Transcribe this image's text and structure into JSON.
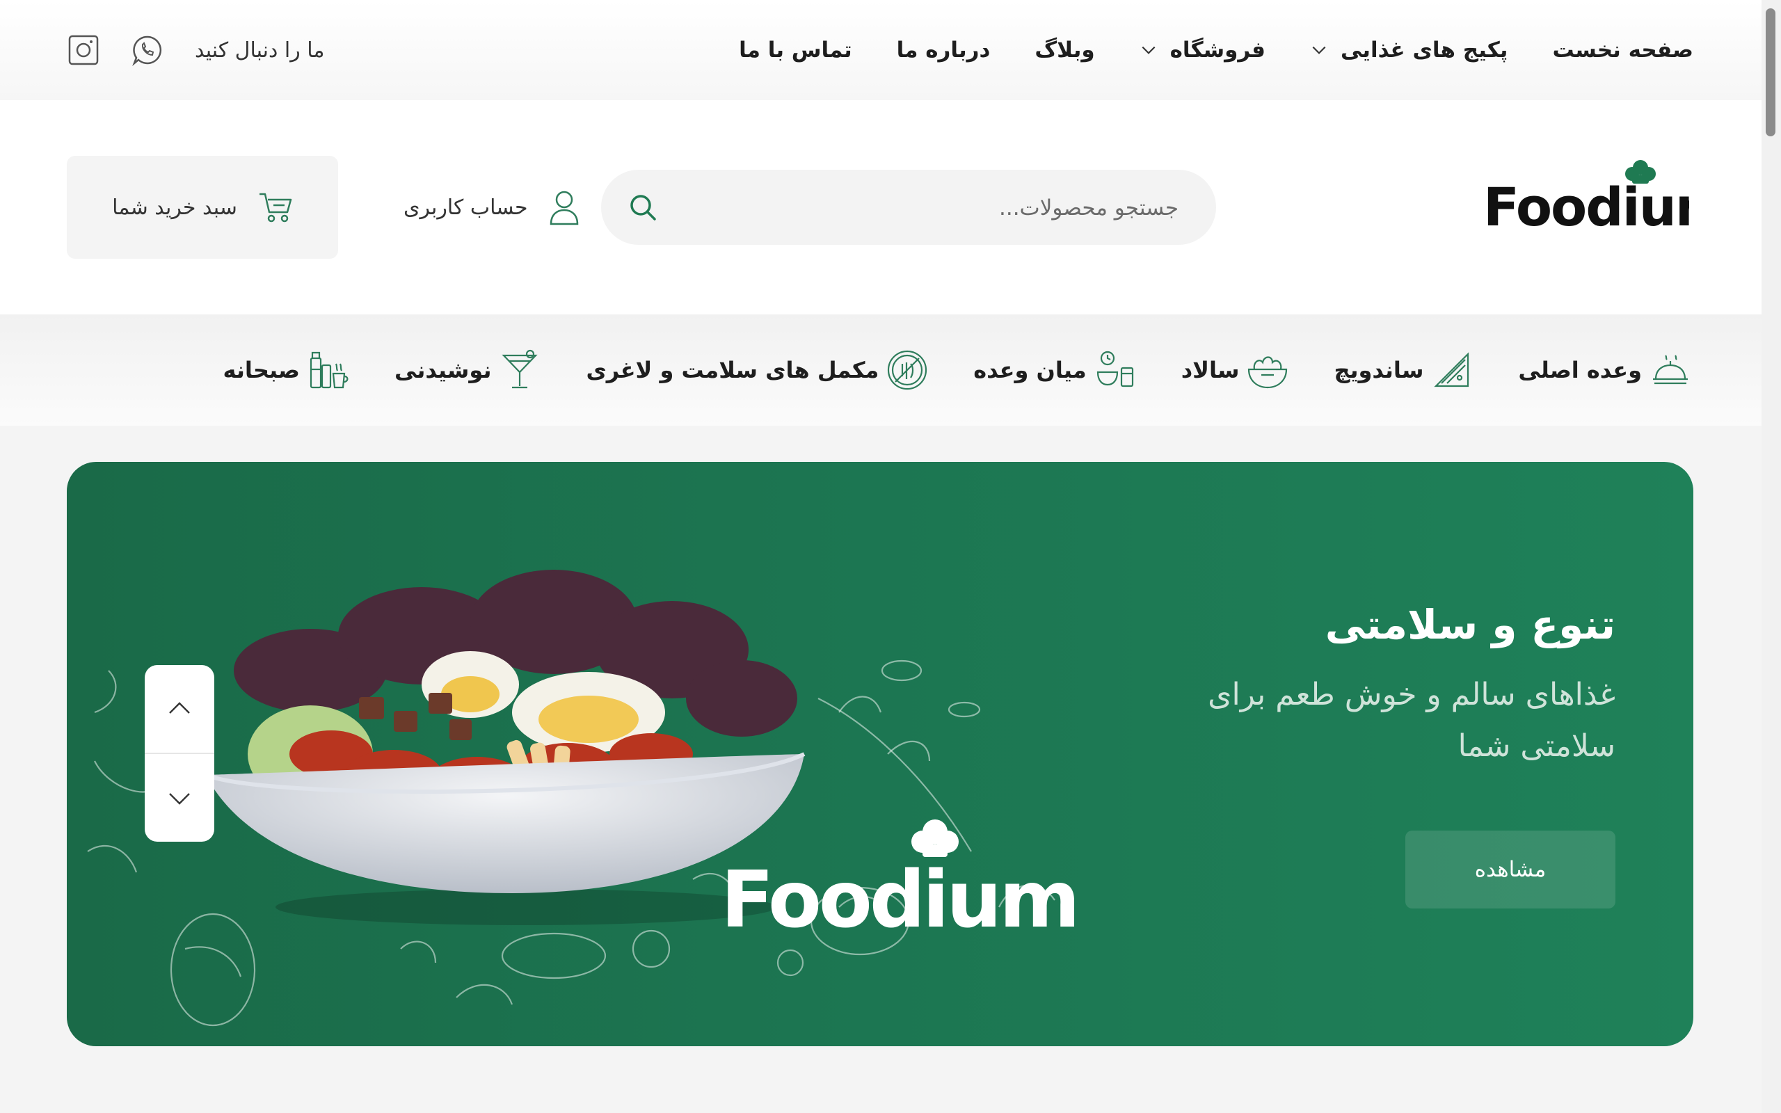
{
  "topbar": {
    "nav": [
      {
        "label": "صفحه نخست",
        "has_dropdown": false
      },
      {
        "label": "پکیج های غذایی",
        "has_dropdown": true
      },
      {
        "label": "فروشگاه",
        "has_dropdown": true
      },
      {
        "label": "وبلاگ",
        "has_dropdown": false
      },
      {
        "label": "درباره ما",
        "has_dropdown": false
      },
      {
        "label": "تماس با ما",
        "has_dropdown": false
      }
    ],
    "follow_label": "ما را دنبال کنید",
    "social_icons": [
      "whatsapp-icon",
      "instagram-icon"
    ]
  },
  "header": {
    "logo_text": "Foodium",
    "search_placeholder": "جستجو محصولات...",
    "account_label": "حساب کاربری",
    "cart_label": "سبد خرید شما"
  },
  "categories": [
    {
      "label": "وعده اصلی",
      "icon": "main-dish-icon"
    },
    {
      "label": "ساندویچ",
      "icon": "sandwich-icon"
    },
    {
      "label": "سالاد",
      "icon": "salad-icon"
    },
    {
      "label": "میان وعده",
      "icon": "snack-icon"
    },
    {
      "label": "مکمل های سلامت و لاغری",
      "icon": "supplement-icon"
    },
    {
      "label": "نوشیدنی",
      "icon": "drink-icon"
    },
    {
      "label": "صبحانه",
      "icon": "breakfast-icon"
    }
  ],
  "hero": {
    "title": "تنوع و سلامتی",
    "subtitle": "غذاهای سالم و خوش طعم برای سلامتی شما",
    "button_label": "مشاهده",
    "logo_text": "Foodium"
  },
  "colors": {
    "brand_green": "#1f7a52",
    "icon_green": "#2f7d5c",
    "hero_text_muted": "#cfe3d9"
  }
}
